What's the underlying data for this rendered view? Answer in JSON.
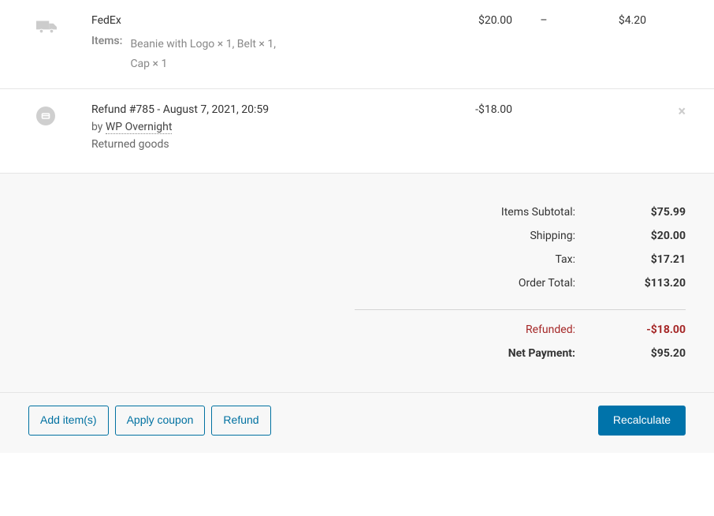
{
  "shipping": {
    "method": "FedEx",
    "amount": "$20.00",
    "dash": "–",
    "tax": "$4.20",
    "items_label": "Items:",
    "items_value": "Beanie with Logo × 1, Belt × 1, Cap × 1"
  },
  "refund": {
    "title": "Refund #785 - August 7, 2021, 20:59",
    "by_prefix": "by ",
    "by_name": "WP Overnight",
    "reason": "Returned goods",
    "amount": "-$18.00",
    "close_glyph": "×"
  },
  "totals": {
    "subtotal_label": "Items Subtotal:",
    "subtotal_value": "$75.99",
    "shipping_label": "Shipping:",
    "shipping_value": "$20.00",
    "tax_label": "Tax:",
    "tax_value": "$17.21",
    "order_total_label": "Order Total:",
    "order_total_value": "$113.20",
    "refunded_label": "Refunded:",
    "refunded_value": "-$18.00",
    "net_label": "Net Payment:",
    "net_value": "$95.20"
  },
  "actions": {
    "add_items": "Add item(s)",
    "apply_coupon": "Apply coupon",
    "refund": "Refund",
    "recalculate": "Recalculate"
  }
}
